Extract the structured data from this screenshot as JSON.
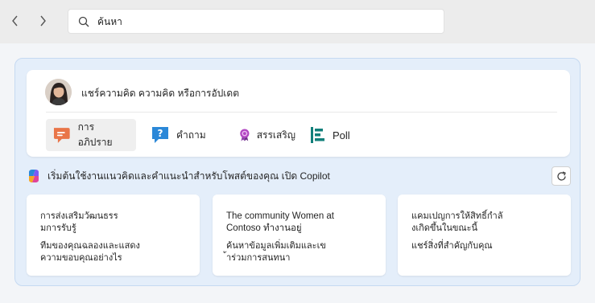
{
  "search": {
    "value": "ค้นหา"
  },
  "composer": {
    "prompt": "แชร์ความคิด ความคิด หรือการอัปเดต",
    "post_types": [
      {
        "label": "การอภิปราย",
        "icon": "discussion-icon",
        "selected": true,
        "color": "#e97548"
      },
      {
        "label": "คำถาม",
        "icon": "question-icon",
        "selected": false,
        "color": "#2b88d8"
      },
      {
        "label": "สรรเสริญ",
        "icon": "praise-icon",
        "selected": false,
        "color": "#8a3fa8"
      },
      {
        "label": "Poll",
        "icon": "poll-icon",
        "selected": false,
        "color": "#117f7a"
      }
    ]
  },
  "suggestions": {
    "heading": "เริ่มต้นใช้งานแนวคิดและคำแนะนำสำหรับโพสต์ของคุณ  เปิด Copilot",
    "cards": [
      {
        "title_line1": "การส่งเสริมวัฒนธรร",
        "title_line2": "มการรับรู้",
        "sub_line1": "ทีมของคุณฉลองและแสดง",
        "sub_line2": "ความขอบคุณอย่างไร"
      },
      {
        "title_line1": "The community Women at",
        "title_line2": "Contoso ทำงานอยู่",
        "sub_line1": "ค้นหาข้อมูลเพิ่มเติมและเข",
        "sub_line2": "้าร่วมการสนทนา"
      },
      {
        "title_line1": "แคมเปญการให้สิทธิ์กำลั",
        "title_line2": "งเกิดขึ้นในขณะนี้",
        "sub_line1": "แชร์สิ่งที่สำคัญกับคุณ",
        "sub_line2": ""
      }
    ]
  },
  "colors": {
    "accent": "#0f6cbd",
    "panel_bg": "#e4eefa",
    "panel_border": "#c5d9f1"
  }
}
